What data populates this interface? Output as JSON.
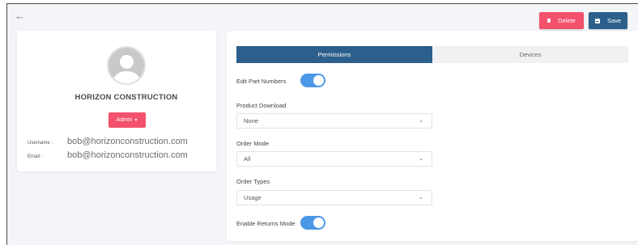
{
  "header": {
    "delete_label": "Delete",
    "save_label": "Save"
  },
  "profile": {
    "company_name": "HORIZON CONSTRUCTION",
    "role_label": "Admin",
    "username_label": "Username :",
    "username_value": "bob@horizonconstruction.com",
    "email_label": "Email :",
    "email_value": "bob@horizonconstruction.com"
  },
  "tabs": [
    {
      "label": "Permissions",
      "active": true
    },
    {
      "label": "Devices",
      "active": false
    }
  ],
  "permissions": {
    "edit_part_numbers_label": "Edit Part Numbers",
    "edit_part_numbers_on": true,
    "product_download_label": "Product Download",
    "product_download_value": "None",
    "order_mode_label": "Order Mode",
    "order_mode_value": "All",
    "order_types_label": "Order Types",
    "order_types_value": "Usage",
    "enable_returns_label": "Enable Returns Mode",
    "enable_returns_on": true
  },
  "colors": {
    "delete": "#f4516c",
    "primary": "#2c5f8b",
    "toggle_on": "#4c98e8"
  },
  "icons": [
    "back-arrow-icon",
    "trash-icon",
    "save-icon",
    "user-avatar-icon",
    "caret-down-icon",
    "chevron-down-icon"
  ]
}
